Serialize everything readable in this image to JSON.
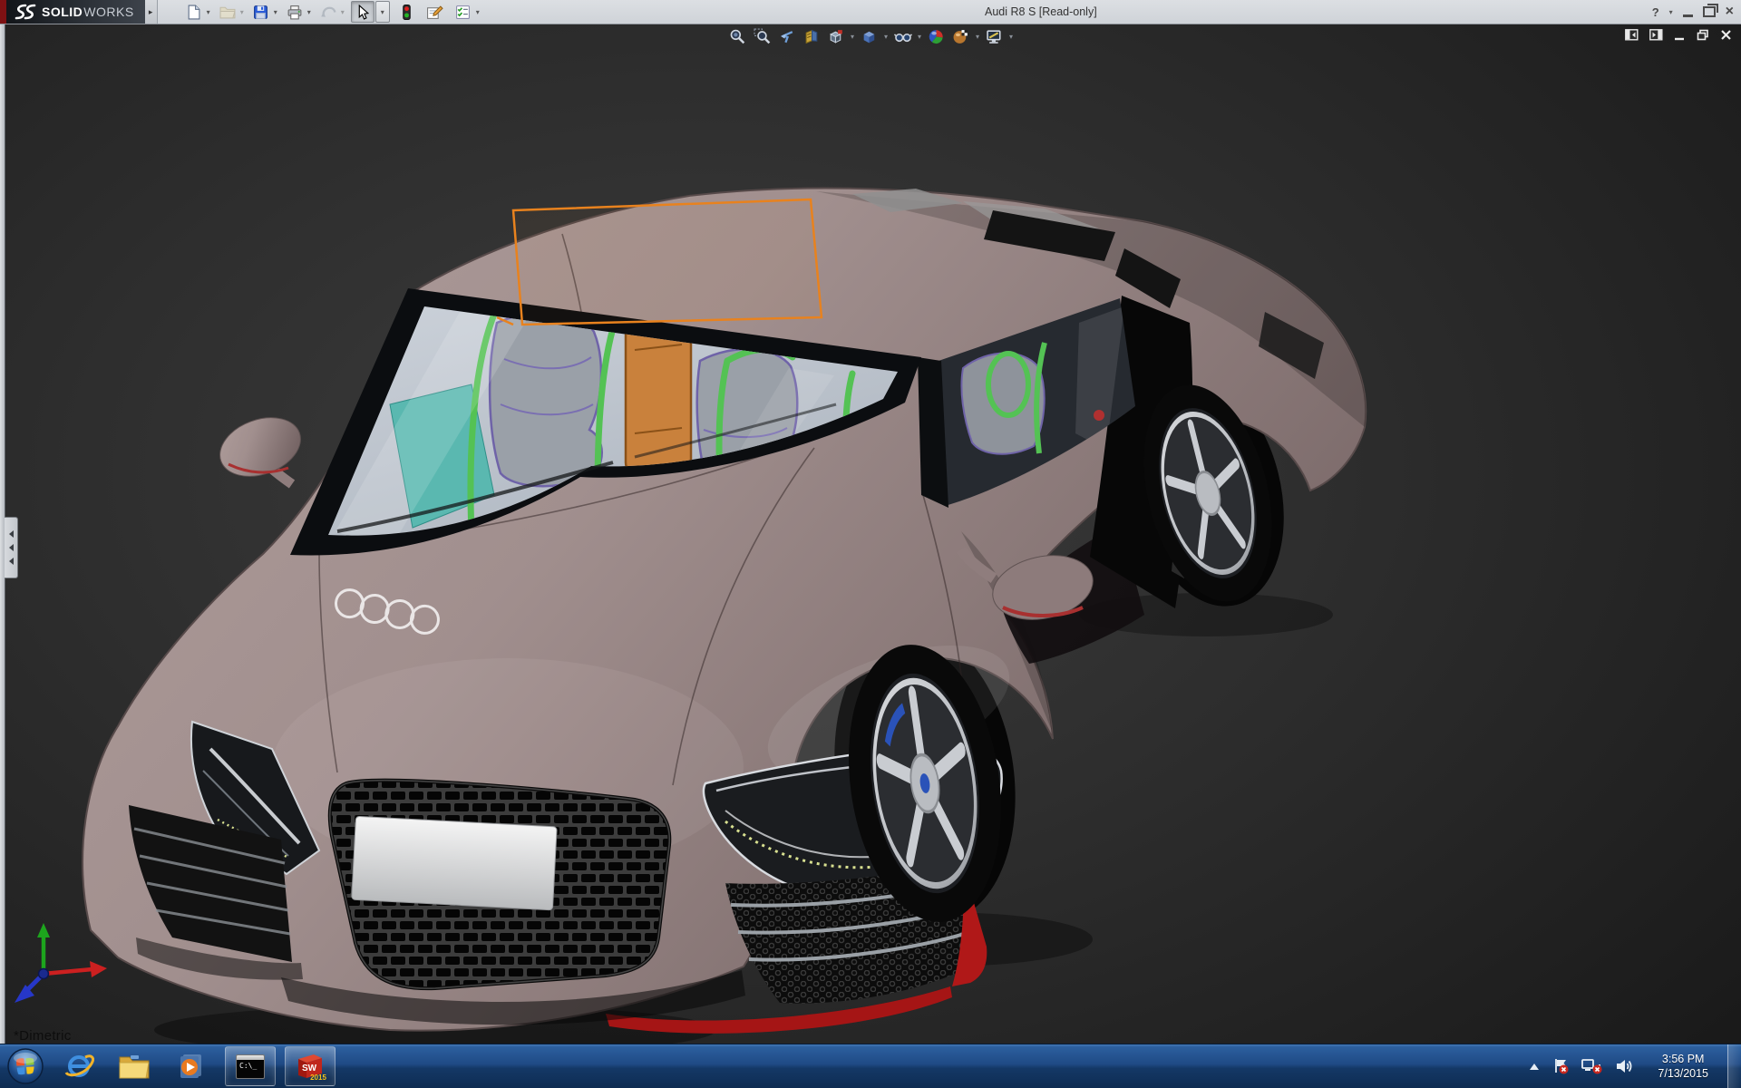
{
  "window": {
    "brand": {
      "name_bold": "SOLID",
      "name_light": "WORKS"
    },
    "flyout_arrow": "▸",
    "title": "Audi R8 S [Read-only]",
    "help_label": "?",
    "close_label": "×"
  },
  "ui": {
    "caret": "▾"
  },
  "toolbar": {
    "icons": [
      "new-document",
      "open-document",
      "save",
      "print",
      "undo",
      "select-cursor",
      "interference-traffic-light",
      "file-properties",
      "options-checklist"
    ]
  },
  "headsup": {
    "icons": [
      "zoom-to-fit",
      "zoom-to-area",
      "previous-view",
      "section-view",
      "view-orientation",
      "display-style",
      "hide-show-items",
      "edit-appearance",
      "apply-scene",
      "view-settings"
    ]
  },
  "viewport": {
    "orientation_label": "*Dimetric",
    "left_tab": "collapse-feature-manager-panel",
    "doc_controls": [
      "pane-left",
      "pane-right",
      "minimize",
      "restore",
      "close"
    ]
  },
  "model": {
    "name": "Audi R8 S",
    "body_color": "#a18f8f",
    "selection_outline_color": "#e8821e",
    "roll_cage_color": "#54c254",
    "dash_color": "#5ab8b0",
    "seat_insert_color": "#c9813c"
  },
  "taskbar": {
    "start": "windows-start",
    "pinned": [
      "internet-explorer",
      "file-explorer",
      "media-player"
    ],
    "running": [
      "command-prompt",
      "solidworks-2015"
    ],
    "cmd_text": "C:\\_",
    "sw_text": "SW",
    "sw_year": "2015",
    "tray_icons": [
      "show-hidden-icons",
      "action-center",
      "network-disconnected",
      "volume"
    ],
    "clock": {
      "time": "3:56 PM",
      "date": "7/13/2015"
    }
  }
}
